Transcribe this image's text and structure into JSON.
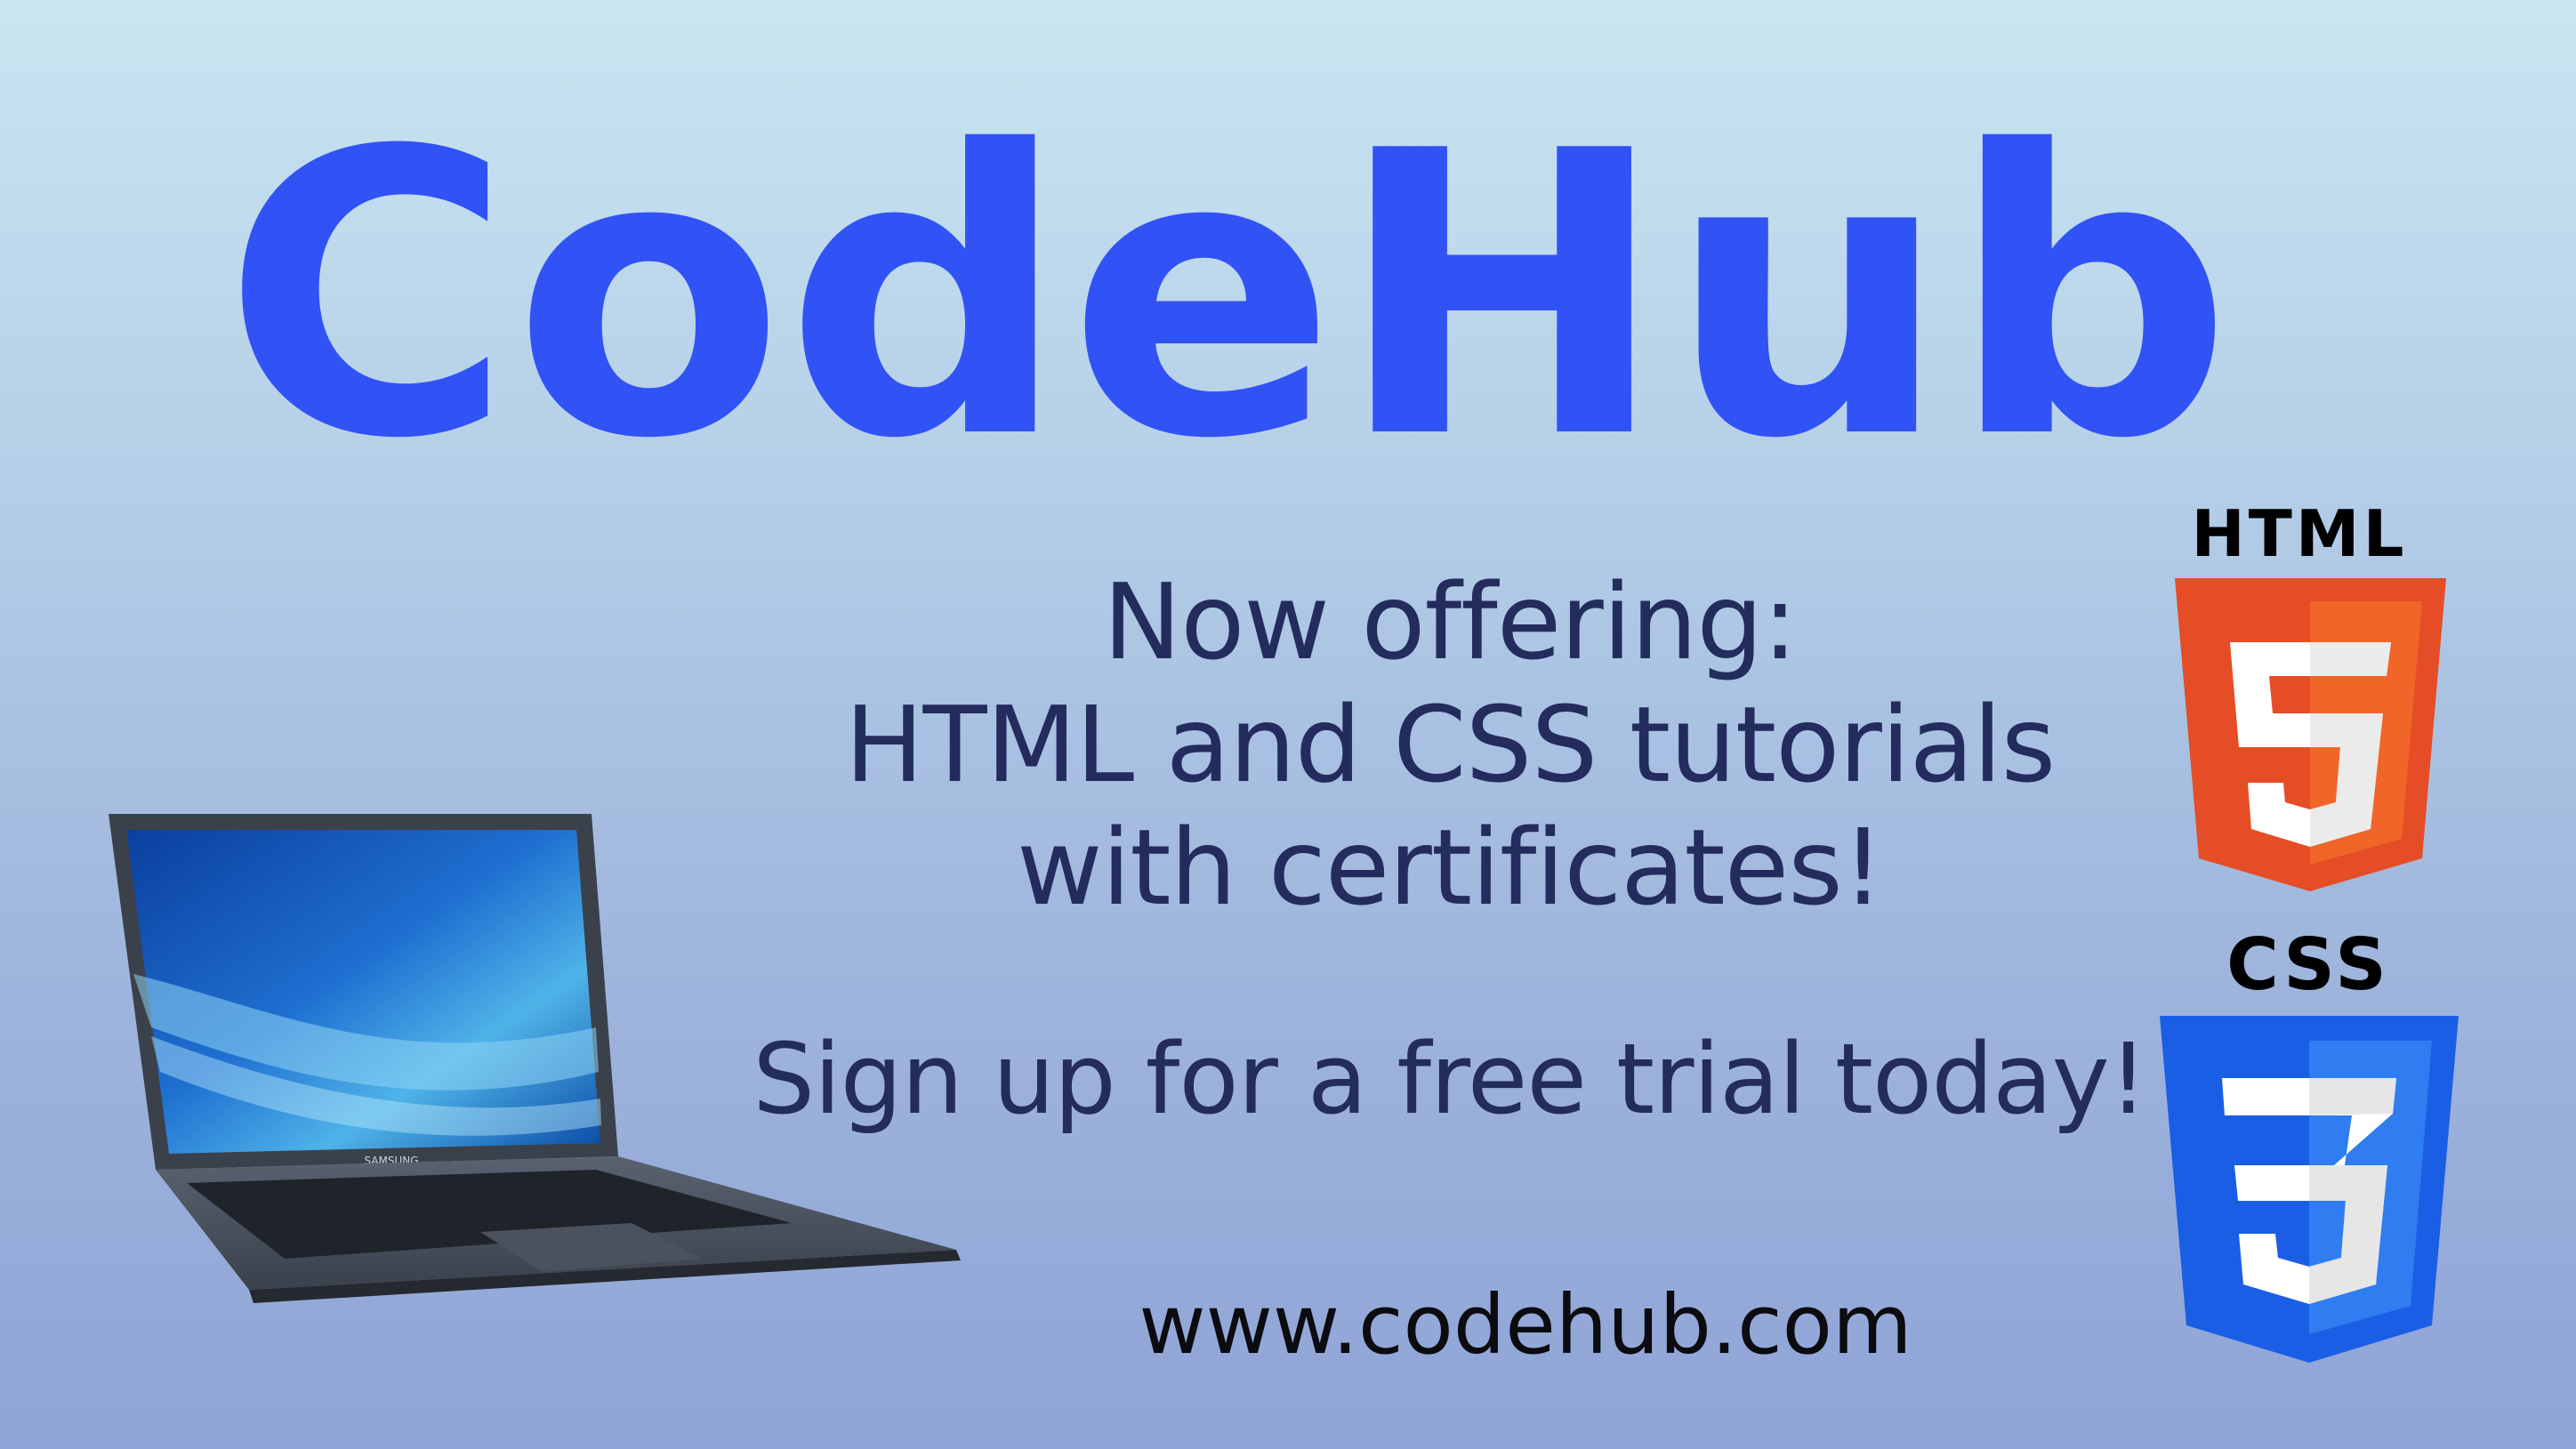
{
  "brand": {
    "name": "CodeHub",
    "color": "#3152f5"
  },
  "headline": {
    "line1": "Now offering:",
    "line2": "HTML and CSS tutorials",
    "line3": "with certificates!"
  },
  "cta": "Sign up for a free trial today!",
  "url": "www.codehub.com",
  "laptop": {
    "icon": "laptop-icon",
    "brand_label": "SAMSUNG"
  },
  "html_badge": {
    "label": "HTML",
    "icon": "html5-shield-icon",
    "colors": {
      "outer": "#e44d26",
      "inner": "#f16529",
      "glyph": "#ffffff"
    }
  },
  "css_badge": {
    "label": "CSS",
    "icon": "css3-shield-icon",
    "colors": {
      "outer": "#1b5ee6",
      "inner": "#2f7df0",
      "glyph": "#ffffff"
    }
  },
  "colors": {
    "text": "#232c5c",
    "url_text": "#0b0b10",
    "background_top": "#c9e6f1",
    "background_bottom": "#8fa4d6"
  }
}
